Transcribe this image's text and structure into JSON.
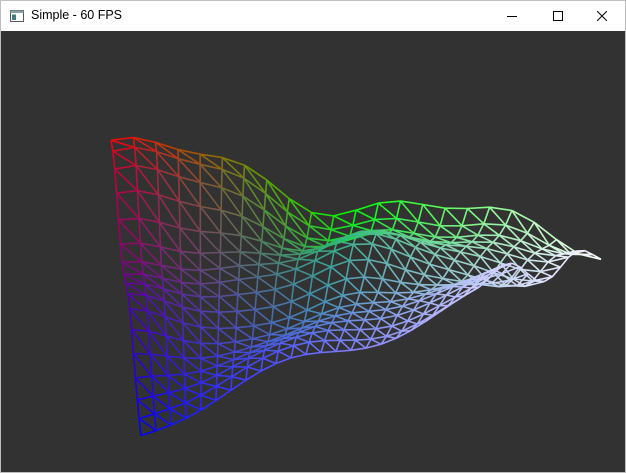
{
  "window": {
    "title": "Simple - 60 FPS",
    "icon": "app-window-icon",
    "controls": [
      {
        "name": "minimize-button",
        "icon": "minimize-icon"
      },
      {
        "name": "maximize-button",
        "icon": "maximize-icon"
      },
      {
        "name": "close-button",
        "icon": "close-icon"
      }
    ]
  },
  "viewport": {
    "background": "#323232",
    "content": "wireframe-terrain-mesh",
    "color_corners": {
      "left_back": "#ff0000",
      "right_back": "#ffffff",
      "left_front": "#0000ff",
      "center_back": "#00ff00"
    }
  }
}
